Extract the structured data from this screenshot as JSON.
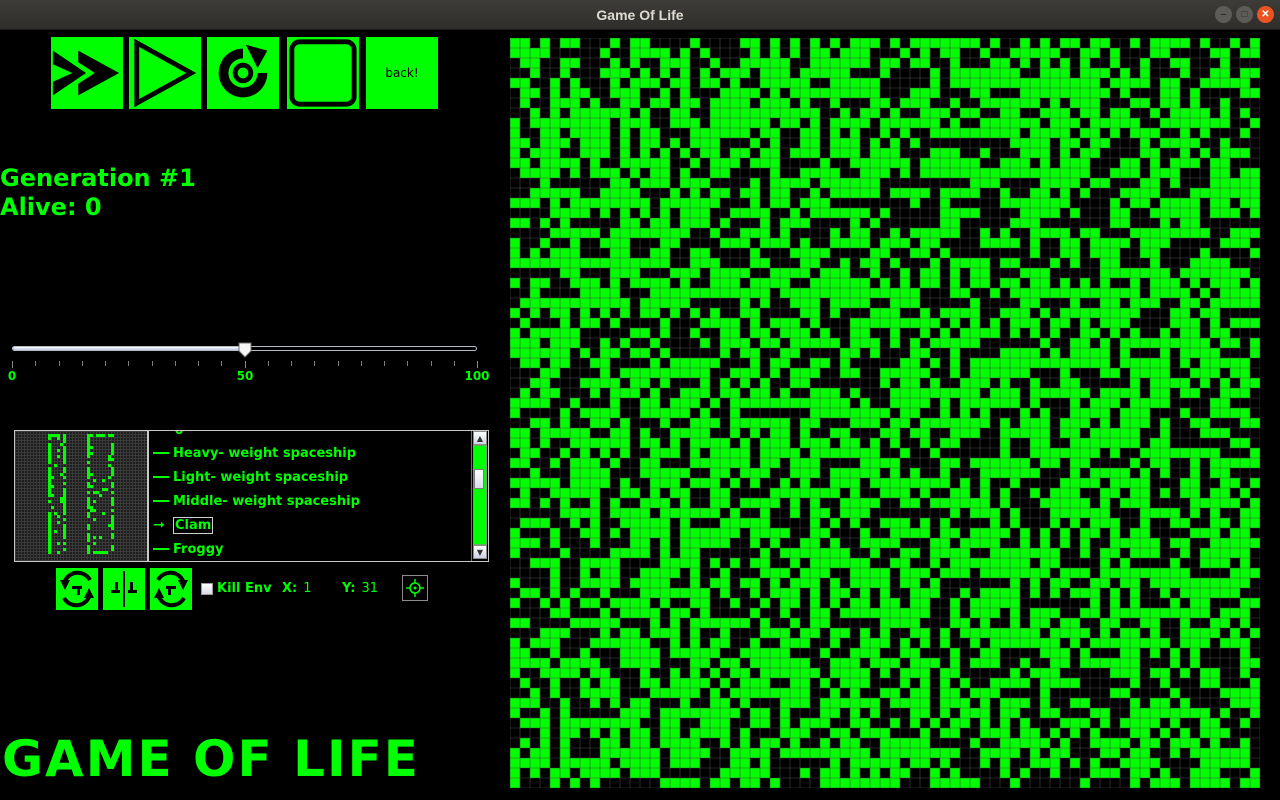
{
  "window": {
    "title": "Game Of Life",
    "controls": [
      "minimize-icon",
      "maximize-icon",
      "close-icon"
    ]
  },
  "toolbar": {
    "buttons": [
      {
        "name": "fast-forward-button",
        "icon": "fast-forward-icon"
      },
      {
        "name": "play-button",
        "icon": "play-icon"
      },
      {
        "name": "reset-button",
        "icon": "reset-icon"
      },
      {
        "name": "stop-button",
        "icon": "stop-icon"
      },
      {
        "name": "back-button",
        "label": "back!"
      }
    ]
  },
  "stats": {
    "generation": "Generation #1",
    "alive": "Alive: 0"
  },
  "speed_slider": {
    "min": "0",
    "mid": "50",
    "max": "100",
    "value": 50
  },
  "patterns": {
    "items": [
      {
        "label": "Heavy- weight spaceship",
        "marker": "dash"
      },
      {
        "label": "Light- weight spaceship",
        "marker": "dash"
      },
      {
        "label": "Middle- weight spaceship",
        "marker": "dash"
      },
      {
        "label": "Clam",
        "marker": "arrow",
        "selected": true
      },
      {
        "label": "Froggy",
        "marker": "dash"
      }
    ]
  },
  "transform_buttons": [
    "rotate-left-icon",
    "mirror-icon",
    "rotate-right-icon"
  ],
  "env": {
    "kill_env_label": "Kill Env",
    "kill_env_checked": false,
    "x_label": "X:",
    "x_value": "1",
    "y_label": "Y:",
    "y_value": "31",
    "target_icon": "crosshair-icon"
  },
  "app_title": "GAME OF LIFE",
  "colors": {
    "accent": "#00ff00",
    "background": "#000000",
    "titlebar": "#333330",
    "close": "#e95420"
  },
  "board": {
    "columns": 75,
    "rows": 75,
    "state": "random fill"
  }
}
